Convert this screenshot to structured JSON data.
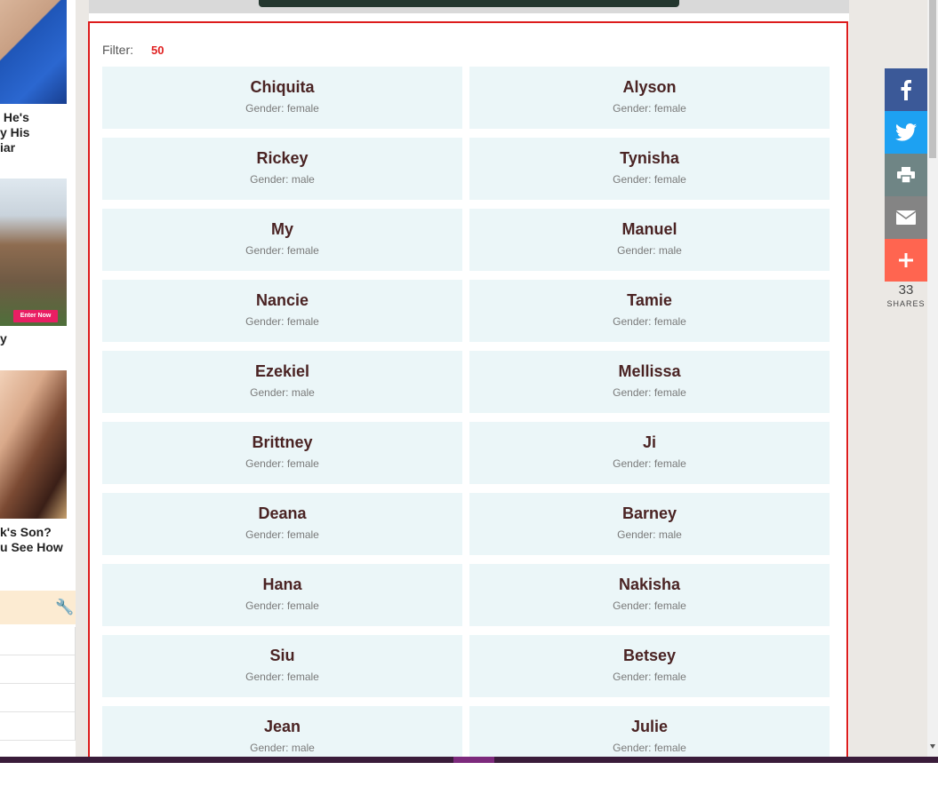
{
  "left_ads": [
    {
      "caption": " He's\ny His\niar"
    },
    {
      "caption": "y",
      "button": "Enter Now"
    },
    {
      "caption": "k's Son?\nu See How"
    }
  ],
  "filter": {
    "label": "Filter:",
    "count": "50"
  },
  "people": [
    {
      "name": "Chiquita",
      "gender": "Gender: female"
    },
    {
      "name": "Alyson",
      "gender": "Gender: female"
    },
    {
      "name": "Rickey",
      "gender": "Gender: male"
    },
    {
      "name": "Tynisha",
      "gender": "Gender: female"
    },
    {
      "name": "My",
      "gender": "Gender: female"
    },
    {
      "name": "Manuel",
      "gender": "Gender: male"
    },
    {
      "name": "Nancie",
      "gender": "Gender: female"
    },
    {
      "name": "Tamie",
      "gender": "Gender: female"
    },
    {
      "name": "Ezekiel",
      "gender": "Gender: male"
    },
    {
      "name": "Mellissa",
      "gender": "Gender: female"
    },
    {
      "name": "Brittney",
      "gender": "Gender: female"
    },
    {
      "name": "Ji",
      "gender": "Gender: female"
    },
    {
      "name": "Deana",
      "gender": "Gender: female"
    },
    {
      "name": "Barney",
      "gender": "Gender: male"
    },
    {
      "name": "Hana",
      "gender": "Gender: female"
    },
    {
      "name": "Nakisha",
      "gender": "Gender: female"
    },
    {
      "name": "Siu",
      "gender": "Gender: female"
    },
    {
      "name": "Betsey",
      "gender": "Gender: female"
    },
    {
      "name": "Jean",
      "gender": "Gender: male"
    },
    {
      "name": "Julie",
      "gender": "Gender: female"
    }
  ],
  "share_bar": {
    "buttons": [
      {
        "icon": "facebook-icon",
        "color": "#3b5998"
      },
      {
        "icon": "twitter-icon",
        "color": "#1da1f2"
      },
      {
        "icon": "print-icon",
        "color": "#6f8585"
      },
      {
        "icon": "email-icon",
        "color": "#848484"
      },
      {
        "icon": "plus-icon",
        "color": "#ff6550"
      }
    ],
    "count": "33",
    "label": "SHARES"
  },
  "colors": {
    "panel_border": "#dd1c1c",
    "card_bg": "#ebf6f8",
    "name_text": "#4a2323",
    "filter_count": "#e02020"
  }
}
